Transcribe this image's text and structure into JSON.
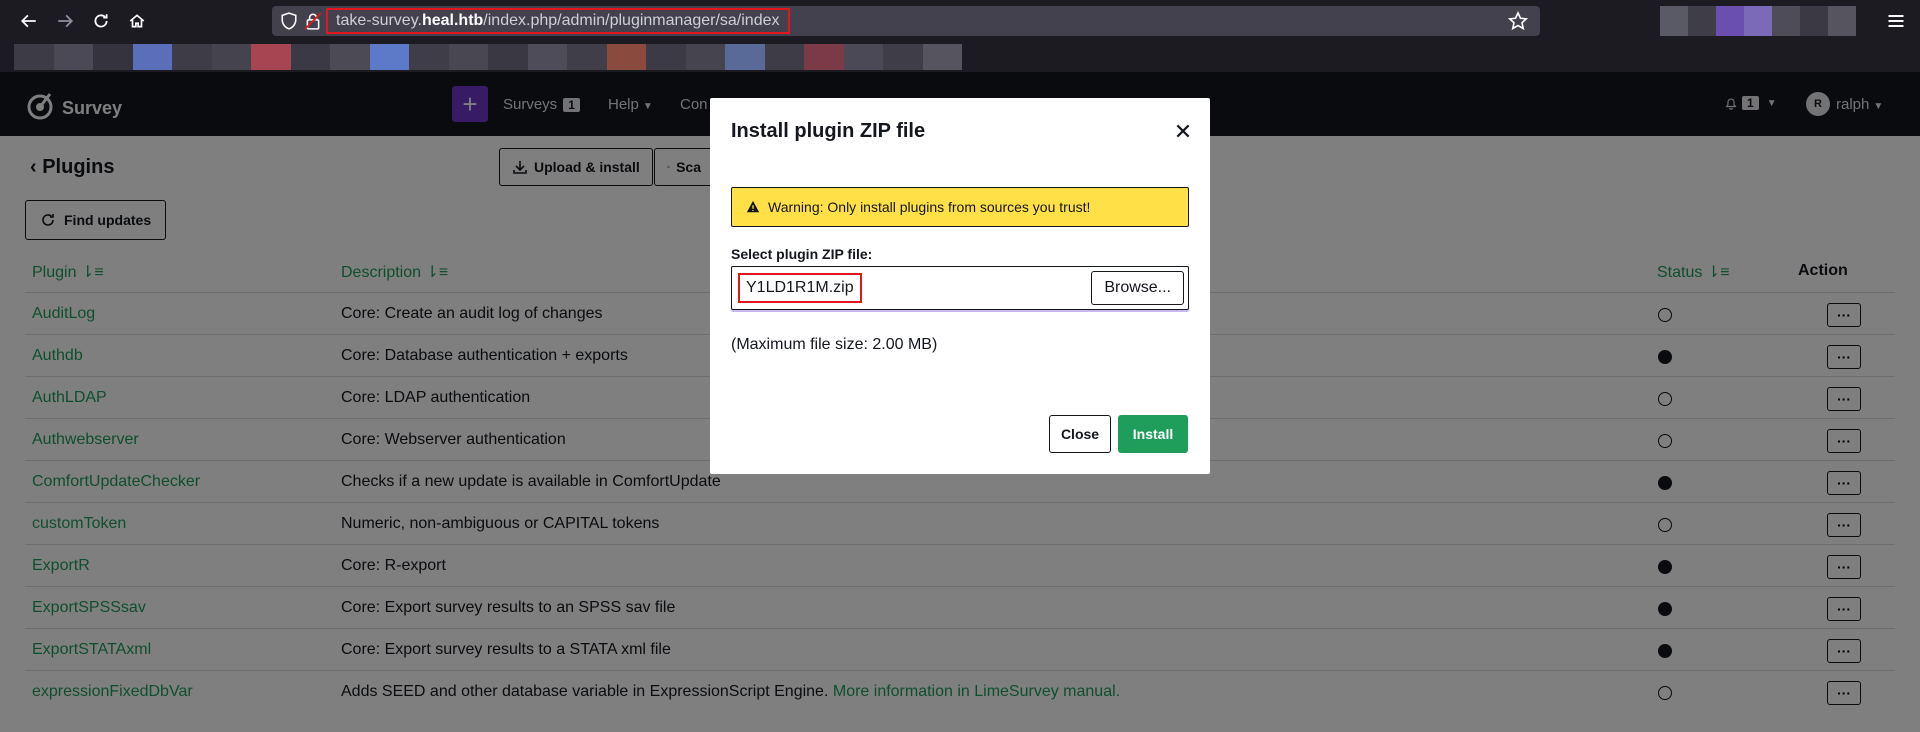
{
  "browser": {
    "url_prefix": "take-survey.",
    "url_domain": "heal.htb",
    "url_path": "/index.php/admin/pluginmanager/sa/index",
    "ext_colors": [
      "#5a5a66",
      "#3e3d48",
      "#6a4fb0",
      "#7a6ab8",
      "#4d4c58",
      "#3a3944",
      "#55545f"
    ],
    "bookmark_colors": [
      "#3c3b46",
      "#4a4955",
      "#34333e",
      "#5a6fb8",
      "#3d3c47",
      "#44434e",
      "#a84552",
      "#3a3944",
      "#4b4a55",
      "#5c7ac8",
      "#3e3d48",
      "#484752",
      "#393843",
      "#4d4c58",
      "#3f3e49",
      "#8a4a3e",
      "#3b3a45",
      "#46454f",
      "#5a6a98",
      "#3d3c47",
      "#7a3a48",
      "#4a4955",
      "#3e3d48",
      "#55545f"
    ]
  },
  "header": {
    "logo_text": "Survey",
    "menu": [
      {
        "label": "Surveys",
        "badge": "1"
      },
      {
        "label": "Help"
      },
      {
        "label": "Con"
      }
    ],
    "notifications_count": "1",
    "avatar_initial": "R",
    "username": "ralph"
  },
  "page": {
    "title": "Plugins",
    "upload_label": "Upload & install",
    "scan_label": "Sca",
    "find_updates_label": "Find updates",
    "columns": {
      "plugin": "Plugin",
      "description": "Description",
      "status": "Status",
      "action": "Action"
    },
    "rows": [
      {
        "name": "AuditLog",
        "desc": "Core: Create an audit log of changes",
        "active": false
      },
      {
        "name": "Authdb",
        "desc": "Core: Database authentication + exports",
        "active": true
      },
      {
        "name": "AuthLDAP",
        "desc": "Core: LDAP authentication",
        "active": false
      },
      {
        "name": "Authwebserver",
        "desc": "Core: Webserver authentication",
        "active": false
      },
      {
        "name": "ComfortUpdateChecker",
        "desc": "Checks if a new update is available in ComfortUpdate",
        "active": true
      },
      {
        "name": "customToken",
        "desc": "Numeric, non-ambiguous or CAPITAL tokens",
        "active": false
      },
      {
        "name": "ExportR",
        "desc": "Core: R-export",
        "active": true
      },
      {
        "name": "ExportSPSSsav",
        "desc": "Core: Export survey results to an SPSS sav file",
        "active": true
      },
      {
        "name": "ExportSTATAxml",
        "desc": "Core: Export survey results to a STATA xml file",
        "active": true
      },
      {
        "name": "expressionFixedDbVar",
        "desc": "Adds SEED and other database variable in ExpressionScript Engine.",
        "link": "More information in LimeSurvey manual.",
        "active": false
      }
    ],
    "action_label": "···"
  },
  "modal": {
    "title": "Install plugin ZIP file",
    "warning": "Warning: Only install plugins from sources you trust!",
    "file_label": "Select plugin ZIP file:",
    "file_name": "Y1LD1R1M.zip",
    "browse_label": "Browse...",
    "max_size": "(Maximum file size: 2.00 MB)",
    "close_label": "Close",
    "install_label": "Install"
  },
  "colors": {
    "accent_green": "#1e9d5b",
    "warning_yellow": "#ffe046",
    "highlight_red": "#e0181e",
    "add_purple": "#6e36c8"
  }
}
